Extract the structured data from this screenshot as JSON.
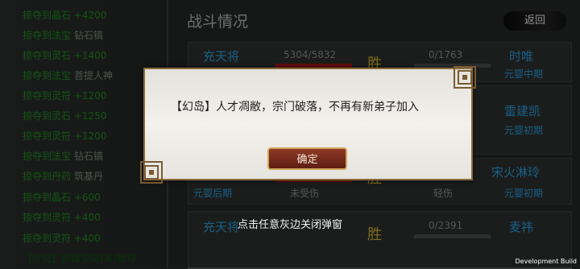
{
  "loot_log": [
    {
      "prefix": "掠夺到晶石 +4200",
      "item": ""
    },
    {
      "prefix": "掠夺到法宝",
      "item": "钻石镐"
    },
    {
      "prefix": "掠夺到灵石 +1400",
      "item": ""
    },
    {
      "prefix": "掠夺到法宝",
      "item": "菩提人神"
    },
    {
      "prefix": "掠夺到灵符 +1200",
      "item": ""
    },
    {
      "prefix": "掠夺到灵石 +1250",
      "item": ""
    },
    {
      "prefix": "掠夺到灵符 +1200",
      "item": ""
    },
    {
      "prefix": "掠夺到法宝",
      "item": "钻石镐"
    },
    {
      "prefix": "掠夺到丹药",
      "item": "筑基丹"
    },
    {
      "prefix": "掠夺到晶石 +600",
      "item": ""
    },
    {
      "prefix": "掠夺到灵符 +400",
      "item": ""
    },
    {
      "prefix": "掠夺到灵符 +400",
      "item": ""
    },
    {
      "prefix": "【传说】凯维宝符(米)掠夺",
      "item": ""
    }
  ],
  "panel": {
    "title": "战斗情况",
    "back": "返回"
  },
  "battles": [
    {
      "left_name": "充天将",
      "left_hp": "5304/5832",
      "result": "胜",
      "right_hp": "0/1763",
      "right_name": "时唯",
      "right_rank": "元婴中期"
    },
    {
      "right_name": "雷建凯",
      "right_rank": "元婴初期"
    },
    {
      "left_rank": "元婴后期",
      "left_status": "未受伤",
      "result": "胜",
      "right_status": "轻伤",
      "right_name": "宋火淋玲",
      "right_rank": "元婴初期"
    },
    {
      "left_name": "充天将",
      "result": "胜",
      "right_hp": "0/2391",
      "right_name": "麦祎"
    }
  ],
  "dialog": {
    "message": "【幻岛】人才凋敝，宗门破落，不再有新弟子加入",
    "ok": "确定",
    "hint": "点击任意灰边关闭弹窗"
  },
  "dev_label": "Development Build"
}
